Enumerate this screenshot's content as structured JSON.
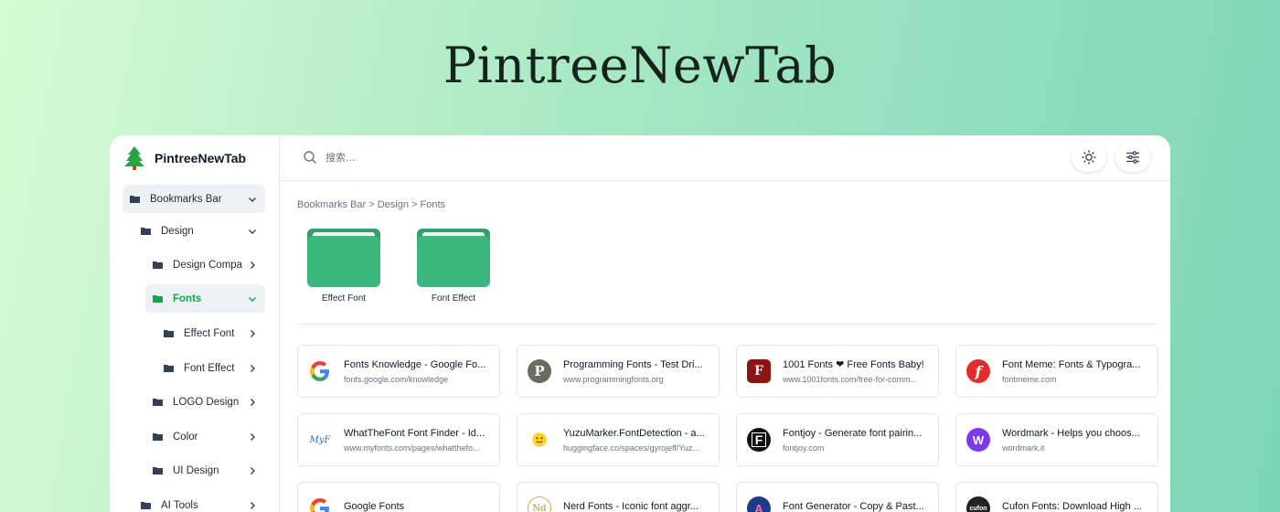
{
  "hero": {
    "title": "PintreeNewTab"
  },
  "brand": {
    "name": "PintreeNewTab"
  },
  "sidebar": {
    "items": [
      {
        "label": "Bookmarks Bar",
        "chevron": "down"
      },
      {
        "label": "Design",
        "chevron": "down"
      },
      {
        "label": "Design Compa",
        "chevron": "right"
      },
      {
        "label": "Fonts",
        "chevron": "down"
      },
      {
        "label": "Effect Font",
        "chevron": "right"
      },
      {
        "label": "Font Effect",
        "chevron": "right"
      },
      {
        "label": "LOGO Design",
        "chevron": "right"
      },
      {
        "label": "Color",
        "chevron": "right"
      },
      {
        "label": "UI Design",
        "chevron": "right"
      },
      {
        "label": "AI Tools",
        "chevron": "right"
      }
    ]
  },
  "search": {
    "placeholder": "搜索..."
  },
  "toolbar": {
    "theme_icon": "sun-icon",
    "settings_icon": "sliders-icon"
  },
  "breadcrumb": "Bookmarks Bar > Design > Fonts",
  "folders": [
    {
      "label": "Effect Font"
    },
    {
      "label": "Font Effect"
    }
  ],
  "colors": {
    "accent": "#16a34a",
    "folder": "#3cb77e"
  },
  "bookmarks": [
    {
      "title": "Fonts Knowledge - Google Fo...",
      "url": "fonts.google.com/knowledge",
      "icon": "google-icon"
    },
    {
      "title": "Programming Fonts - Test Dri...",
      "url": "www.programmingfonts.org",
      "icon": "programmingfonts-icon"
    },
    {
      "title": "1001 Fonts ❤ Free Fonts Baby!",
      "url": "www.1001fonts.com/free-for-comm...",
      "icon": "1001fonts-icon"
    },
    {
      "title": "Font Meme: Fonts & Typogra...",
      "url": "fontmeme.com",
      "icon": "fontmeme-icon"
    },
    {
      "title": "WhatTheFont Font Finder - Id...",
      "url": "www.myfonts.com/pages/whatthefo...",
      "icon": "myfonts-icon"
    },
    {
      "title": "YuzuMarker.FontDetection - a...",
      "url": "huggingface.co/spaces/gyrojeff/Yuz...",
      "icon": "huggingface-icon"
    },
    {
      "title": "Fontjoy - Generate font pairin...",
      "url": "fontjoy.com",
      "icon": "fontjoy-icon"
    },
    {
      "title": "Wordmark - Helps you choos...",
      "url": "wordmark.it",
      "icon": "wordmark-icon"
    },
    {
      "title": "Google Fonts",
      "url": "",
      "icon": "google-icon"
    },
    {
      "title": "Nerd Fonts - Iconic font aggr...",
      "url": "",
      "icon": "nerdfonts-icon"
    },
    {
      "title": "Font Generator - Copy & Past...",
      "url": "",
      "icon": "fontgenerator-icon"
    },
    {
      "title": "Cufon Fonts: Download High ...",
      "url": "",
      "icon": "cufonfonts-icon"
    }
  ]
}
